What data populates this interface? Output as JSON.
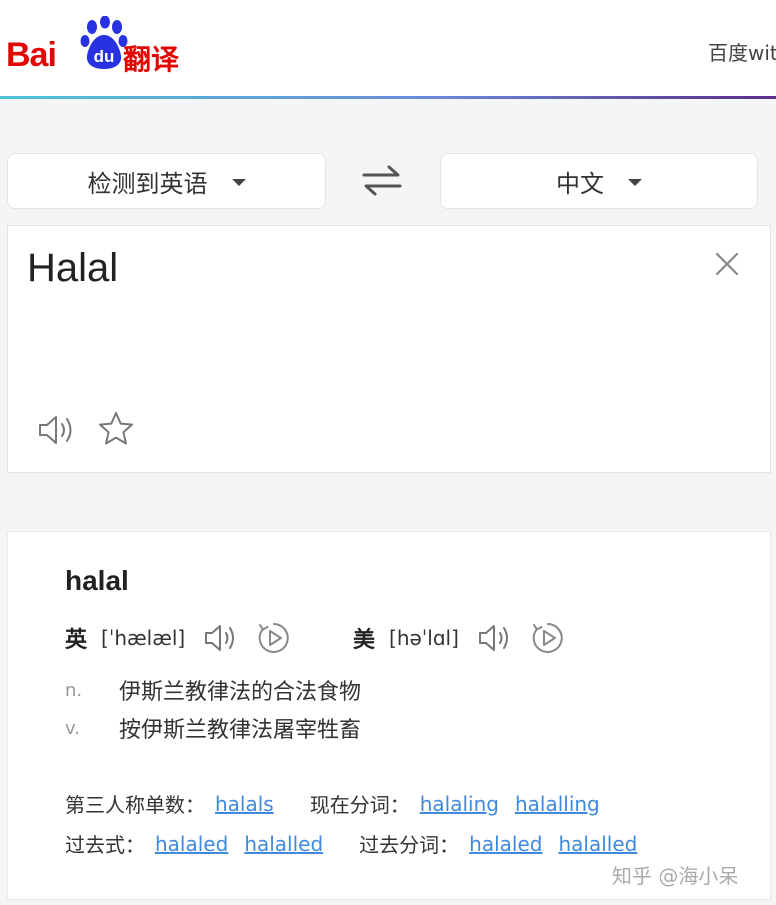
{
  "header": {
    "logo_text": "Bai",
    "logo_du": "du",
    "logo_product": "翻译",
    "right_link": "百度wit"
  },
  "languages": {
    "source": "检测到英语",
    "target": "中文"
  },
  "input": {
    "text": "Halal"
  },
  "result": {
    "word": "halal",
    "uk": {
      "tag": "英",
      "ipa": "[ˈhælæl]"
    },
    "us": {
      "tag": "美",
      "ipa": "[həˈlɑl]"
    },
    "definitions": [
      {
        "pos": "n.",
        "text": "伊斯兰教律法的合法食物"
      },
      {
        "pos": "v.",
        "text": "按伊斯兰教律法屠宰牲畜"
      }
    ],
    "forms": {
      "third_person_label": "第三人称单数：",
      "third_person": [
        "halals"
      ],
      "present_participle_label": "现在分词：",
      "present_participle": [
        "halaling",
        "halalling"
      ],
      "past_tense_label": "过去式：",
      "past_tense": [
        "halaled",
        "halalled"
      ],
      "past_participle_label": "过去分词：",
      "past_participle": [
        "halaled",
        "halalled"
      ]
    }
  },
  "watermark": "知乎 @海小呆",
  "colors": {
    "brand_red": "#e10602",
    "brand_blue": "#2932e1",
    "link": "#3f89de"
  },
  "icons": [
    "swap-icon",
    "close-icon",
    "speaker-icon",
    "star-icon",
    "play-icon"
  ]
}
